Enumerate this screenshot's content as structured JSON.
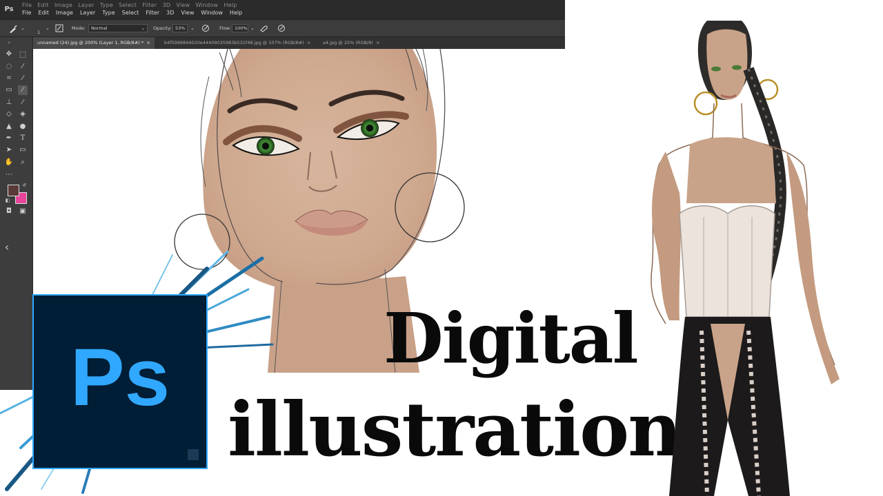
{
  "app": {
    "name": "Photoshop",
    "menu": [
      "File",
      "Edit",
      "Image",
      "Layer",
      "Type",
      "Select",
      "Filter",
      "3D",
      "View",
      "Window",
      "Help"
    ]
  },
  "options_bar": {
    "mode_label": "Mode:",
    "mode_value": "Normal",
    "opacity_label": "Opacity:",
    "opacity_value": "53%",
    "flow_label": "Flow:",
    "flow_value": "100%",
    "brush_size": "1"
  },
  "tabs": [
    {
      "label": "unnamed (24).jpg @ 200% (Layer 1, RGB/8#) *",
      "active": true
    },
    {
      "label": "b4f5996844020e44409035983b531f48.jpg @ 107% (RGB/8#)",
      "active": false
    },
    {
      "label": "a4.jpg @ 25% (RGB/8)",
      "active": false
    }
  ],
  "colors": {
    "foreground": "#5a3a38",
    "background": "#e8449a",
    "ps_blue": "#31a8ff",
    "ps_dark": "#001e36"
  },
  "logo": {
    "text": "Ps"
  },
  "title": {
    "line1": "Digital",
    "line2": "illustration"
  },
  "icons": [
    "move-icon",
    "marquee-icon",
    "lasso-icon",
    "magic-wand-icon",
    "crop-icon",
    "eyedropper-icon",
    "brush-icon",
    "stamp-icon",
    "eraser-icon",
    "bucket-icon",
    "pen-icon",
    "type-icon",
    "hand-icon",
    "zoom-icon"
  ]
}
